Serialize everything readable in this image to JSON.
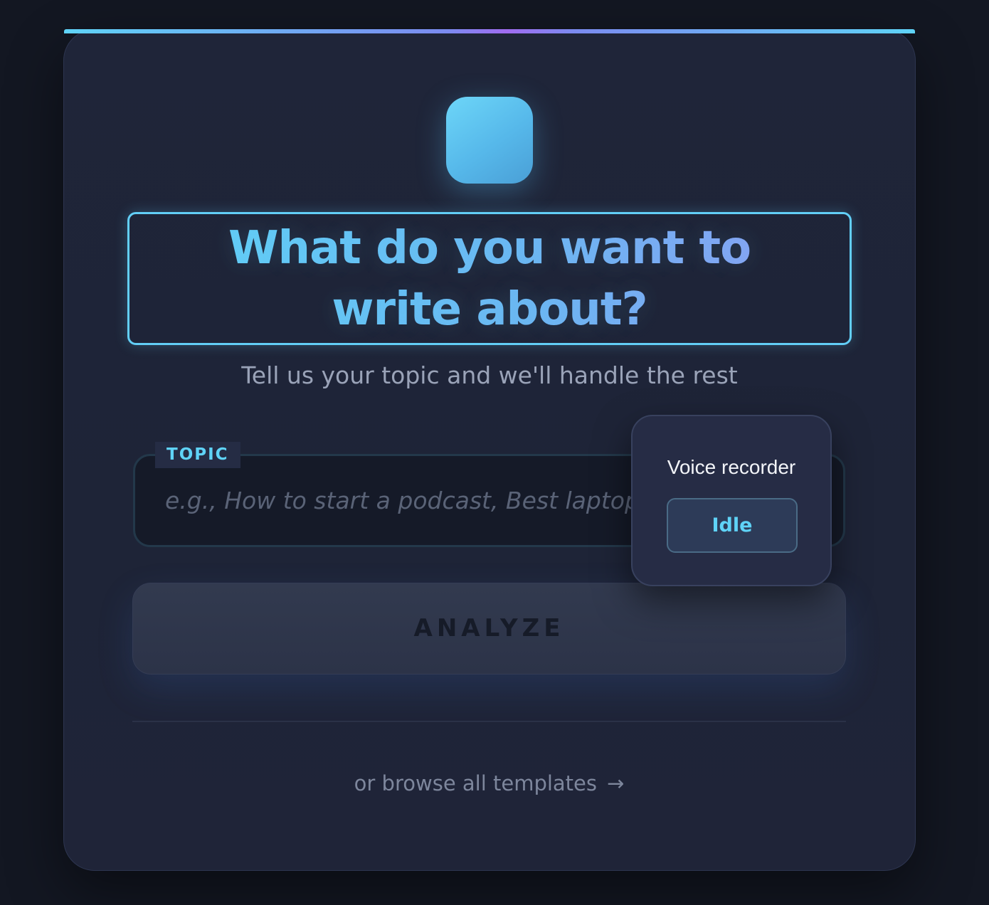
{
  "hero": {
    "title": "What do you want to write about?",
    "subtitle": "Tell us your topic and we'll handle the rest"
  },
  "topic": {
    "label": "TOPIC",
    "placeholder": "e.g., How to start a podcast, Best laptops for students",
    "value": ""
  },
  "actions": {
    "analyze_label": "ANALYZE",
    "browse_label": "or browse all templates",
    "browse_arrow": "→"
  },
  "voice_recorder": {
    "title": "Voice recorder",
    "status": "Idle"
  },
  "colors": {
    "accent_cyan": "#5fd3f7",
    "accent_violet": "#8f9cf3",
    "background": "#131722",
    "card": "#1f2539"
  },
  "icons": {
    "logo": "app-logo-square",
    "browse": "arrow-right-icon"
  }
}
